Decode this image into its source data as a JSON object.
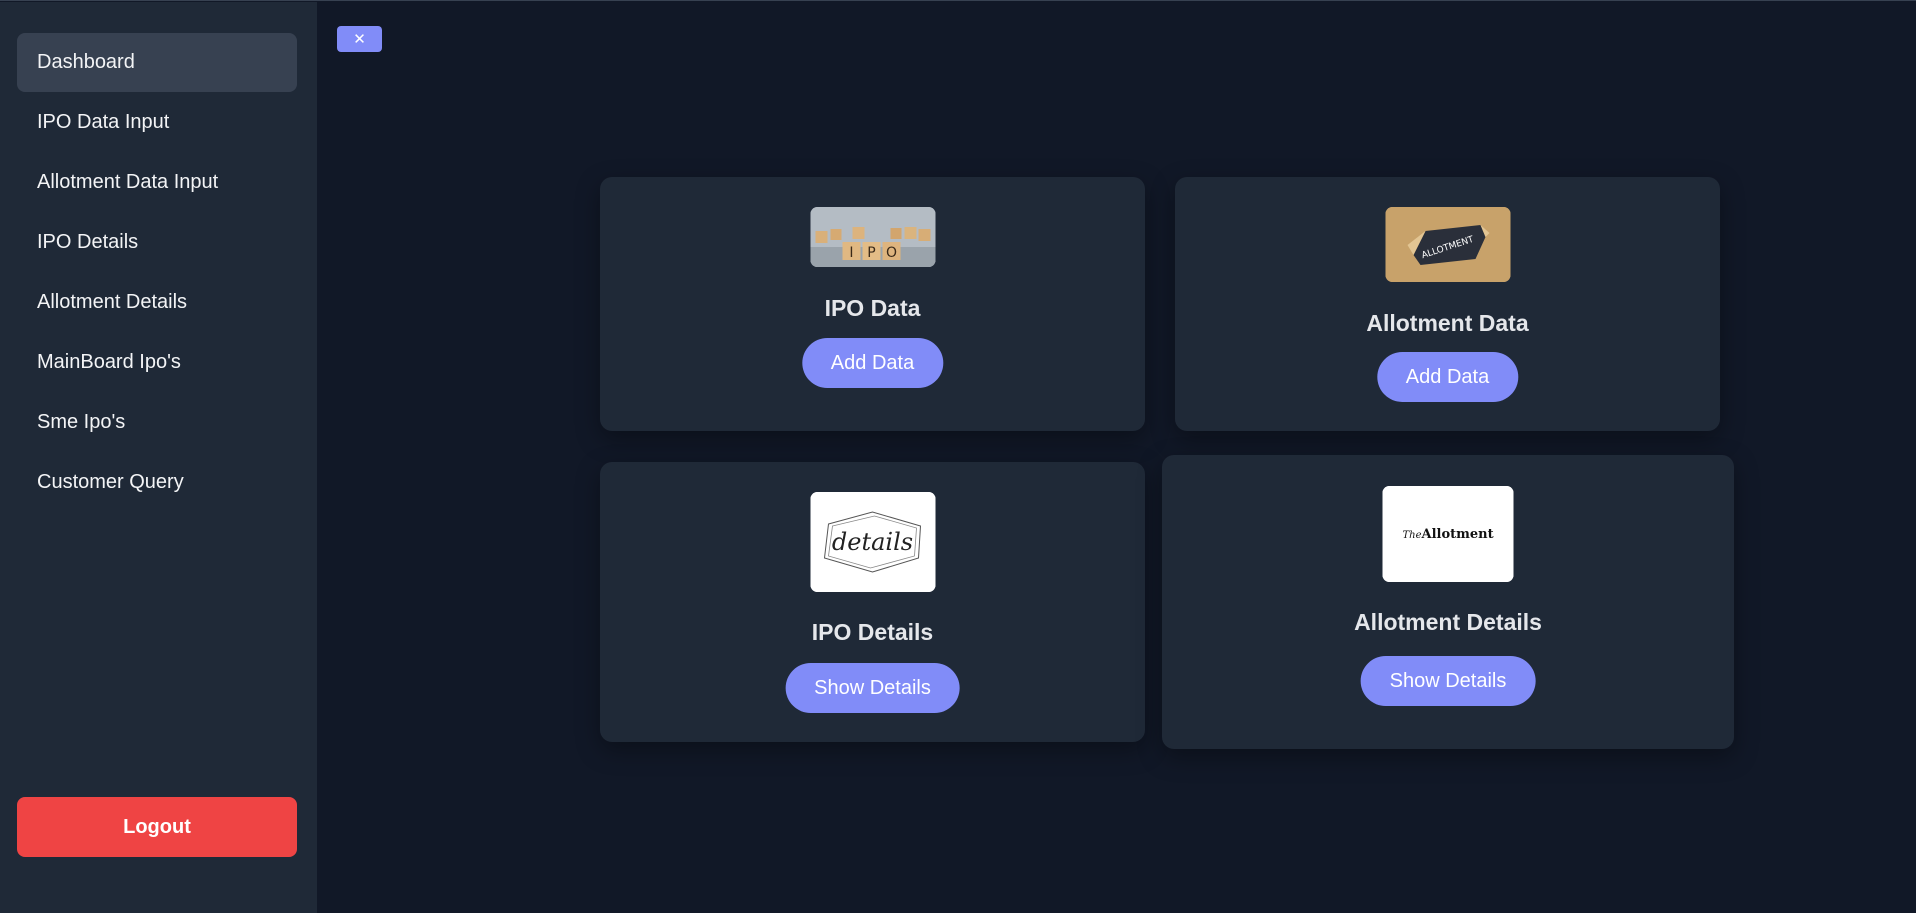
{
  "sidebar": {
    "items": [
      {
        "label": "Dashboard"
      },
      {
        "label": "IPO Data Input"
      },
      {
        "label": "Allotment Data Input"
      },
      {
        "label": "IPO Details"
      },
      {
        "label": "Allotment Details"
      },
      {
        "label": "MainBoard Ipo's"
      },
      {
        "label": "Sme Ipo's"
      },
      {
        "label": "Customer Query"
      }
    ],
    "active_item": "Dashboard",
    "logout_label": "Logout"
  },
  "close_button": {
    "label": "✕"
  },
  "cards": [
    {
      "title": "IPO Data",
      "button_label": "Add Data",
      "image_text": "IPO",
      "image_icon": "ipo-blocks-image"
    },
    {
      "title": "Allotment Data",
      "button_label": "Add Data",
      "image_text": "ALLOTMENT",
      "image_icon": "allotment-paper-image"
    },
    {
      "title": "IPO Details",
      "button_label": "Show Details",
      "image_text": "details",
      "image_icon": "details-script-image"
    },
    {
      "title": "Allotment Details",
      "button_label": "Show Details",
      "image_text_small": "The",
      "image_text": "Allotment",
      "image_icon": "the-allotment-logo-image"
    }
  ],
  "colors": {
    "background": "#111827",
    "sidebar": "#1f2937",
    "card": "#1f2937",
    "accent": "#818cf8",
    "logout": "#ef4444",
    "active_item": "#374151"
  }
}
